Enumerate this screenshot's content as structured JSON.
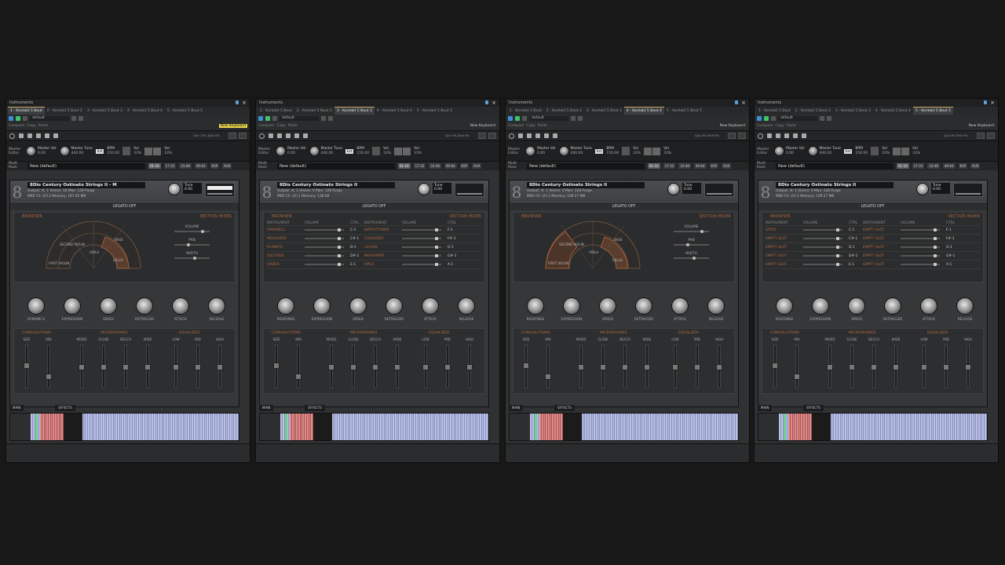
{
  "windows": [
    {
      "title": "Instruments",
      "tabs": [
        "1 - Kontakt 5 Bout",
        "2 - Kontakt 5 Bout 2",
        "3 - Kontakt 5 Bout 3",
        "4 - Kontakt 5 Bout 4",
        "5 - Kontakt 5 Bout 5"
      ],
      "active_tab": 0,
      "host": {
        "preset": "default",
        "compare": "Compare",
        "copy": "Copy",
        "paste": "Paste",
        "new_keyboard": "New Keyboard",
        "highlight": true
      },
      "cpu": "Cpu 12%  Disk 0%",
      "master": {
        "editor": "Master Editor",
        "vol_label": "Master Vol",
        "vol": "0.00",
        "tune_label": "Master Tune",
        "tune": "440.00",
        "ext": "Ext",
        "bpm_label": "BPM",
        "bpm": "150.00",
        "vol2_label": "Vol",
        "vol2": "33%"
      },
      "rack": {
        "label": "Multi Rack",
        "preset": "New (default)",
        "ranges": [
          "01-16",
          "17-32",
          "33-48",
          "49-64",
          "KSP",
          "AUX"
        ]
      },
      "instrument": {
        "name": "8Dio Century Ostinato Strings II - M",
        "output": "Output: st. 1",
        "voices": "Voices: 16  Max: 128  Purge",
        "midi": "MIDI Ch: [A] 2",
        "memory": "Memory: 187.05 MB",
        "tune": "Tune",
        "tune_val": "0.00"
      },
      "legato": "LEGATO OFF",
      "mode": "fan",
      "browser": "BROWSER",
      "section_mixer": "SECTION MIXER",
      "fan_labels": [
        "SECOND VIOLIN",
        "VIOLA",
        "BASS",
        "CELLO",
        "FIRST VIOLIN"
      ],
      "mixer_sliders": [
        "VOLUME",
        "PAN",
        "WIDTH"
      ],
      "knobs": [
        "DYNAMICS",
        "EXPRESSION",
        "SPEED",
        "RETRIGGER",
        "ATTACK",
        "RELEASE"
      ],
      "lower": {
        "conv": "CONVOLUTIONS",
        "mics": "MICROPHONES",
        "eq": "EQUALIZER",
        "cols": [
          "SIZE",
          "MIX",
          "MIXED",
          "CLOSE",
          "DECCA",
          "WIDE",
          "LOW",
          "MID",
          "HIGH"
        ]
      },
      "bottom_tabs": [
        "MAIN",
        "EFFECTS"
      ]
    },
    {
      "title": "Instruments",
      "tabs": [
        "1 - Kontakt 5 Bout",
        "2 - Kontakt 5 Bout 2",
        "3 - Kontakt 5 Bout 3",
        "4 - Kontakt 5 Bout 4",
        "5 - Kontakt 5 Bout 5"
      ],
      "active_tab": 2,
      "host": {
        "preset": "default",
        "compare": "Compare",
        "copy": "Copy",
        "paste": "Paste",
        "new_keyboard": "New Keyboard",
        "highlight": false
      },
      "cpu": "Cpu 0%  Disk 0%",
      "master": {
        "editor": "Master Editor",
        "vol_label": "Master Vol",
        "vol": "0.00",
        "tune_label": "Master Tune",
        "tune": "440.00",
        "ext": "Ext",
        "bpm_label": "BPM",
        "bpm": "150.00",
        "vol2_label": "Vol",
        "vol2": "33%"
      },
      "rack": {
        "label": "Multi Rack",
        "preset": "New (default)",
        "ranges": [
          "01-16",
          "17-32",
          "33-48",
          "49-64",
          "KSP",
          "AUX"
        ]
      },
      "instrument": {
        "name": "8Dio Century Ostinato Strings II",
        "output": "Output: st. 1",
        "voices": "Voices: 0  Max: 128  Purge",
        "midi": "MIDI Ch: [A] 1",
        "memory": "Memory: 138.08",
        "tune": "Tune",
        "tune_val": "0.00"
      },
      "legato": "LEGATO OFF",
      "mode": "table",
      "browser": "BROWSER",
      "section_mixer": "SECTION MIXER",
      "table_headers": [
        "INSTRUMENT",
        "VOLUME",
        "CTRL",
        "INSTRUMENT",
        "VOLUME",
        "CTRL"
      ],
      "table_rows": [
        [
          "FAREWELL",
          "C-1",
          "WATCHTOWER",
          "F-1"
        ],
        [
          "MEASURED",
          "C#-1",
          "CRUSADER",
          "F#-1"
        ],
        [
          "PLANETS",
          "D-1",
          "LEGION",
          "G-1"
        ],
        [
          "SOLITUDE",
          "D#-1",
          "MOVEMENT",
          "G#-1"
        ],
        [
          "ORDER",
          "E-1",
          "OPUS",
          "A-1"
        ]
      ],
      "knobs": [
        "RESPONSE",
        "EXPRESSION",
        "SPEED",
        "RETRIGGER",
        "ATTACK",
        "RELEASE"
      ],
      "lower": {
        "conv": "CONVOLUTIONS",
        "mics": "MICROPHONES",
        "eq": "EQUALIZER",
        "cols": [
          "SIZE",
          "MIX",
          "MIXED",
          "CLOSE",
          "DECCA",
          "WIDE",
          "LOW",
          "MID",
          "HIGH"
        ]
      },
      "bottom_tabs": [
        "MAIN",
        "EFFECTS"
      ]
    },
    {
      "title": "Instruments",
      "tabs": [
        "1 - Kontakt 5 Bout",
        "2 - Kontakt 5 Bout 2",
        "3 - Kontakt 5 Bout 3",
        "4 - Kontakt 5 Bout 4",
        "5 - Kontakt 5 Bout 5"
      ],
      "active_tab": 3,
      "host": {
        "preset": "default",
        "compare": "Compare",
        "copy": "Copy",
        "paste": "Paste",
        "new_keyboard": "New Keyboard",
        "highlight": false
      },
      "cpu": "Cpu 0%  Disk 0%",
      "master": {
        "editor": "Master Editor",
        "vol_label": "Master Vol",
        "vol": "0.00",
        "tune_label": "Master Tune",
        "tune": "440.00",
        "ext": "Ext",
        "bpm_label": "BPM",
        "bpm": "150.00",
        "vol2_label": "Vol",
        "vol2": "33%"
      },
      "rack": {
        "label": "Multi Rack",
        "preset": "New (default)",
        "ranges": [
          "01-16",
          "17-32",
          "33-48",
          "49-64",
          "KSP",
          "AUX"
        ]
      },
      "instrument": {
        "name": "8Dio Century Ostinato Strings II",
        "output": "Output: st. 1",
        "voices": "Voices: 0  Max: 128  Purge",
        "midi": "MIDI Ch: [A] 1",
        "memory": "Memory: 109.27 MB",
        "tune": "Tune",
        "tune_val": "0.00"
      },
      "legato": "LEGATO OFF",
      "mode": "fan",
      "browser": "BROWSER",
      "section_mixer": "SECTION MIXER",
      "fan_labels": [
        "SECOND VIOLIN",
        "VIOLA",
        "BASS",
        "CELLO",
        "FIRST VIOLIN"
      ],
      "mixer_sliders": [
        "VOLUME",
        "PAN",
        "WIDTH"
      ],
      "knobs": [
        "RESPONSE",
        "EXPRESSION",
        "SPEED",
        "RETRIGGER",
        "ATTACK",
        "RELEASE"
      ],
      "lower": {
        "conv": "CONVOLUTIONS",
        "mics": "MICROPHONES",
        "eq": "EQUALIZER",
        "cols": [
          "SIZE",
          "MIX",
          "MIXED",
          "CLOSE",
          "DECCA",
          "WIDE",
          "LOW",
          "MID",
          "HIGH"
        ]
      },
      "bottom_tabs": [
        "MAIN",
        "EFFECTS"
      ]
    },
    {
      "title": "Instruments",
      "tabs": [
        "1 - Kontakt 5 Bout",
        "2 - Kontakt 5 Bout 2",
        "3 - Kontakt 5 Bout 3",
        "4 - Kontakt 5 Bout 4",
        "5 - Kontakt 5 Bout 5"
      ],
      "active_tab": 4,
      "host": {
        "preset": "default",
        "compare": "Compare",
        "copy": "Copy",
        "paste": "Paste",
        "new_keyboard": "New Keyboard",
        "highlight": false
      },
      "cpu": "Cpu 0%  Disk 0%",
      "master": {
        "editor": "Master Editor",
        "vol_label": "Master Vol",
        "vol": "0.00",
        "tune_label": "Master Tune",
        "tune": "440.00",
        "ext": "Ext",
        "bpm_label": "BPM",
        "bpm": "150.00",
        "vol2_label": "Vol",
        "vol2": "33%"
      },
      "rack": {
        "label": "Multi Rack",
        "preset": "New (default)",
        "ranges": [
          "01-16",
          "17-32",
          "33-48",
          "49-64",
          "KSP",
          "AUX"
        ]
      },
      "instrument": {
        "name": "8Dio Century Ostinato Strings II",
        "output": "Output: st. 1",
        "voices": "Voices: 0  Max: 128  Purge",
        "midi": "MIDI Ch: [A] 1",
        "memory": "Memory: 109.27 MB",
        "tune": "Tune",
        "tune_val": "0.00"
      },
      "legato": "LEGATO OFF",
      "mode": "table",
      "browser": "BROWSER",
      "section_mixer": "SECTION MIXER",
      "table_headers": [
        "INSTRUMENT",
        "VOLUME",
        "CTRL",
        "INSTRUMENT",
        "VOLUME",
        "CTRL"
      ],
      "table_rows": [
        [
          "STATE",
          "C-1",
          "EMPTY SLOT",
          "F-1"
        ],
        [
          "EMPTY SLOT",
          "C#-1",
          "EMPTY SLOT",
          "F#-1"
        ],
        [
          "EMPTY SLOT",
          "D-1",
          "EMPTY SLOT",
          "G-1"
        ],
        [
          "EMPTY SLOT",
          "D#-1",
          "EMPTY SLOT",
          "G#-1"
        ],
        [
          "EMPTY SLOT",
          "E-1",
          "EMPTY SLOT",
          "A-1"
        ]
      ],
      "knobs": [
        "RESPONSE",
        "EXPRESSION",
        "SPEED",
        "RETRIGGER",
        "ATTACK",
        "RELEASE"
      ],
      "lower": {
        "conv": "CONVOLUTIONS",
        "mics": "MICROPHONES",
        "eq": "EQUALIZER",
        "cols": [
          "SIZE",
          "MIX",
          "MIXED",
          "CLOSE",
          "DECCA",
          "WIDE",
          "LOW",
          "MID",
          "HIGH"
        ]
      },
      "bottom_tabs": [
        "MAIN",
        "EFFECTS"
      ]
    }
  ],
  "colors": {
    "accent": "#b06a42",
    "highlight": "#e6d24a",
    "bg": "#181818"
  }
}
